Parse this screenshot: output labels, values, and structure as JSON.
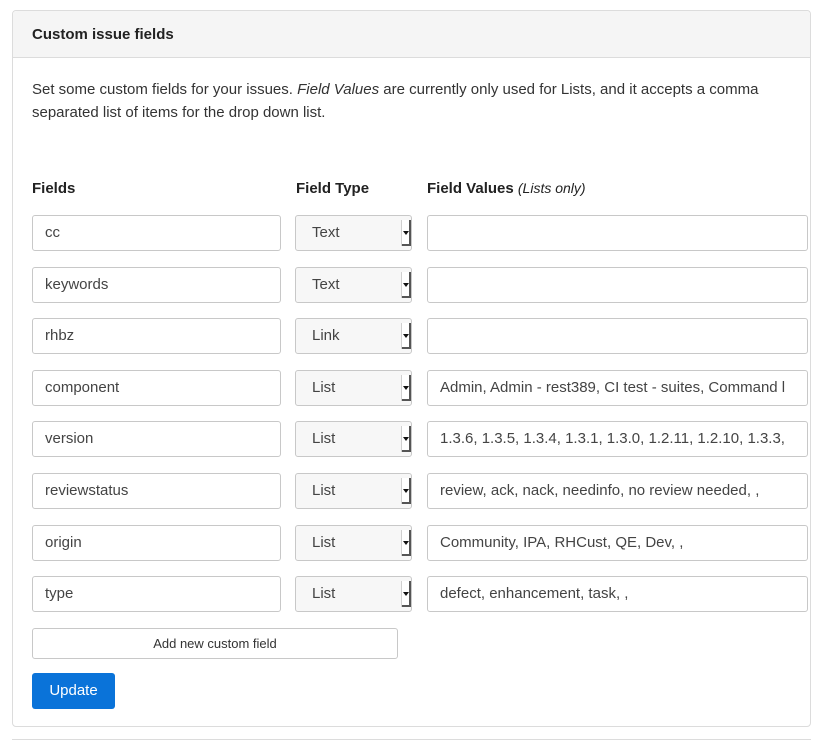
{
  "panel": {
    "title": "Custom issue fields",
    "description_pre": "Set some custom fields for your issues. ",
    "description_em": "Field Values",
    "description_post": " are currently only used for Lists, and it accepts a comma separated list of items for the drop down list."
  },
  "columns": {
    "fields": "Fields",
    "field_type": "Field Type",
    "field_values": "Field Values",
    "field_values_note": "(Lists only)"
  },
  "rows": [
    {
      "name": "cc",
      "type": "Text",
      "values": ""
    },
    {
      "name": "keywords",
      "type": "Text",
      "values": ""
    },
    {
      "name": "rhbz",
      "type": "Link",
      "values": ""
    },
    {
      "name": "component",
      "type": "List",
      "values": "Admin, Admin - rest389, CI test - suites, Command l"
    },
    {
      "name": "version",
      "type": "List",
      "values": "1.3.6, 1.3.5, 1.3.4, 1.3.1, 1.3.0, 1.2.11, 1.2.10, 1.3.3,"
    },
    {
      "name": "reviewstatus",
      "type": "List",
      "values": "review, ack, nack, needinfo, no review needed, ,"
    },
    {
      "name": "origin",
      "type": "List",
      "values": "Community, IPA, RHCust, QE, Dev, ,"
    },
    {
      "name": "type",
      "type": "List",
      "values": "defect, enhancement, task, ,"
    }
  ],
  "buttons": {
    "add_field": "Add new custom field",
    "update": "Update"
  }
}
